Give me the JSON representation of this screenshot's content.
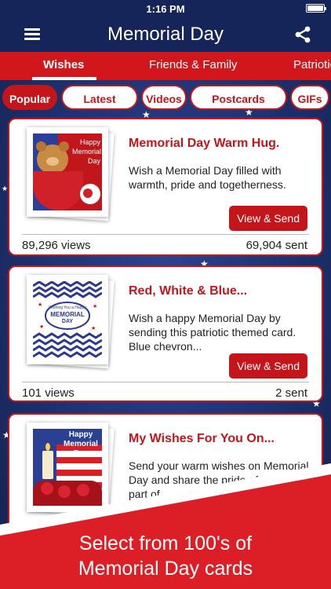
{
  "status": {
    "time": "1:16 PM"
  },
  "header": {
    "title": "Memorial Day"
  },
  "tabs": [
    {
      "label": "Wishes"
    },
    {
      "label": "Friends & Family"
    },
    {
      "label": "Patriotic"
    }
  ],
  "filters": [
    {
      "label": "Popular"
    },
    {
      "label": "Latest"
    },
    {
      "label": "Videos"
    },
    {
      "label": "Postcards"
    },
    {
      "label": "GIFs"
    }
  ],
  "cards": [
    {
      "title": "Memorial Day Warm Hug.",
      "description": "Wish a Memorial Day filled with warmth, pride and togetherness.",
      "button": "View & Send",
      "views": "89,296 views",
      "sent": "69,904 sent",
      "thumb_text": [
        "Happy",
        "Memorial",
        "Day"
      ]
    },
    {
      "title": "Red, White & Blue...",
      "description": "Wish a happy Memorial Day by sending this patriotic themed card. Blue chevron...",
      "button": "View & Send",
      "views": "101 views",
      "sent": "2 sent",
      "thumb_text": [
        "Wishing You a Happy",
        "MEMORIAL",
        "DAY"
      ]
    },
    {
      "title": "My Wishes For You On...",
      "description": "Send your warm wishes on Memorial Day and share the pride of being a part of...",
      "thumb_text": [
        "Happy",
        "Memorial",
        "Day"
      ]
    }
  ],
  "promo": {
    "line1": "Select from 100's of",
    "line2": "Memorial Day cards"
  },
  "colors": {
    "brand_red": "#c4151b",
    "navy": "#15255a"
  }
}
